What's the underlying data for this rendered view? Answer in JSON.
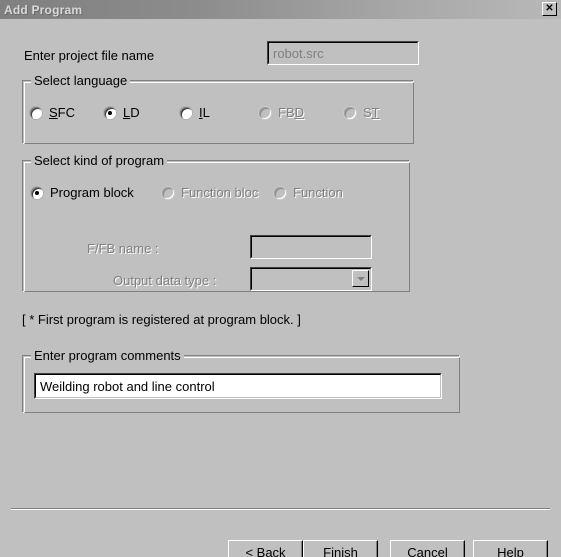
{
  "window": {
    "title": "Add Program",
    "close_label": "✕",
    "close_icon": "close-icon"
  },
  "project": {
    "file_name_label": "Enter project file name",
    "file_name_value": "robot.src",
    "file_name_enabled": false
  },
  "language_group": {
    "title": "Select language",
    "options": [
      {
        "label": "SFC",
        "mnemonic": "S",
        "pre": "",
        "post": "FC",
        "checked": false,
        "enabled": true
      },
      {
        "label": "LD",
        "mnemonic": "L",
        "pre": "",
        "post": "D",
        "checked": true,
        "enabled": true
      },
      {
        "label": "IL",
        "mnemonic": "I",
        "pre": "",
        "post": "L",
        "checked": false,
        "enabled": true
      },
      {
        "label": "FBD",
        "mnemonic": "D",
        "pre": "FB",
        "post": "",
        "checked": false,
        "enabled": false
      },
      {
        "label": "ST",
        "mnemonic": "T",
        "pre": "S",
        "post": "",
        "checked": false,
        "enabled": false
      }
    ]
  },
  "kind_group": {
    "title": "Select kind of program",
    "options": [
      {
        "label": "Program block",
        "checked": true,
        "enabled": true
      },
      {
        "label": "Function bloc",
        "checked": false,
        "enabled": false
      },
      {
        "label": "Function",
        "checked": false,
        "enabled": false
      }
    ],
    "ffb_name_label": "F/FB name :",
    "ffb_name_value": "",
    "ffb_name_enabled": false,
    "output_type_label": "Output data type :",
    "output_type_value": "",
    "output_type_enabled": false
  },
  "note": "[ * First program is registered at program block. ]",
  "comments_group": {
    "title": "Enter program comments",
    "value": "Weilding robot and line control"
  },
  "buttons": {
    "back": {
      "pre": "< ",
      "mnemonic": "B",
      "post": "ack"
    },
    "finish": "Finish",
    "cancel": "Cancel",
    "help": "Help"
  },
  "colors": {
    "face": "#c0c0c0",
    "shadow": "#808080",
    "highlight": "#ffffff",
    "dark": "#000000",
    "disabled_text": "#808080",
    "window": "#ffffff"
  }
}
